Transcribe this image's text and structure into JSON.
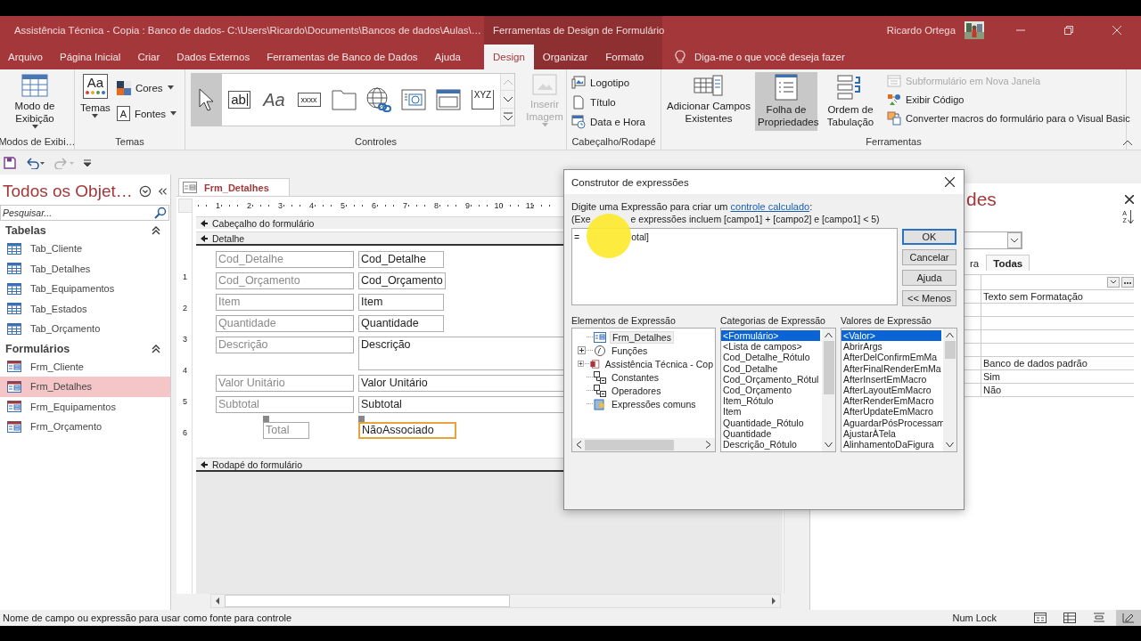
{
  "window": {
    "title": "Assistência Técnica - Copia : Banco de dados- C:\\Users\\Ricardo\\Documents\\Bancos de dados\\Aulas\\…",
    "context_title": "Ferramentas de Design de Formulário",
    "user": "Ricardo Ortega"
  },
  "menu_tabs": [
    {
      "label": "Arquivo",
      "selected": false,
      "context": false
    },
    {
      "label": "Página Inicial",
      "selected": false,
      "context": false
    },
    {
      "label": "Criar",
      "selected": false,
      "context": false
    },
    {
      "label": "Dados Externos",
      "selected": false,
      "context": false
    },
    {
      "label": "Ferramentas de Banco de Dados",
      "selected": false,
      "context": false
    },
    {
      "label": "Ajuda",
      "selected": false,
      "context": false
    },
    {
      "label": "Design",
      "selected": true,
      "context": true
    },
    {
      "label": "Organizar",
      "selected": false,
      "context": true
    },
    {
      "label": "Formato",
      "selected": false,
      "context": true
    }
  ],
  "tell_me": "Diga-me o que você deseja fazer",
  "ribbon": {
    "groups": [
      {
        "kind": "views",
        "label": "Modos de Exibi…",
        "button": "Modo de Exibição"
      },
      {
        "kind": "themes",
        "label": "Temas",
        "big": "Temas",
        "icon_text": "Aa",
        "colors": "Cores",
        "fonts": "Fontes",
        "fonts_icon_text": "A"
      },
      {
        "kind": "controls",
        "label": "Controles",
        "tools": [
          {
            "kind": "pointer",
            "selected": true
          },
          {
            "kind": "textbox",
            "text": "ab",
            "selected": false
          },
          {
            "kind": "label",
            "text": "Aa",
            "selected": false
          },
          {
            "kind": "button",
            "text": "xxxx",
            "selected": false
          },
          {
            "kind": "tab",
            "selected": false
          },
          {
            "kind": "hyperlink",
            "selected": false
          },
          {
            "kind": "webbrowser",
            "selected": false
          },
          {
            "kind": "navigation",
            "selected": false
          },
          {
            "kind": "optiongroup",
            "text": "XYZ",
            "selected": false
          }
        ],
        "insert_image": {
          "label": "Inserir Imagem",
          "disabled": true
        }
      },
      {
        "kind": "header_footer",
        "label": "Cabeçalho/Rodapé",
        "items": [
          {
            "kind": "logo",
            "label": "Logotipo"
          },
          {
            "kind": "title",
            "label": "Título"
          },
          {
            "kind": "datetime",
            "label": "Data e Hora"
          }
        ]
      },
      {
        "kind": "tools",
        "label": "Ferramentas",
        "big": [
          {
            "kind": "fields",
            "label": "Adicionar Campos Existentes",
            "selected": false
          },
          {
            "kind": "properties",
            "label": "Folha de Propriedades",
            "selected": true
          },
          {
            "kind": "taborder",
            "label": "Ordem de Tabulação",
            "selected": false
          }
        ],
        "small": [
          {
            "kind": "subform",
            "label": "Subformulário em Nova Janela",
            "disabled": true
          },
          {
            "kind": "code",
            "label": "Exibir Código",
            "disabled": false
          },
          {
            "kind": "convert",
            "label": "Converter macros do formulário para o Visual Basic",
            "disabled": false
          }
        ]
      }
    ]
  },
  "nav": {
    "title": "Todos os Objet…",
    "search_placeholder": "Pesquisar...",
    "groups": [
      {
        "label": "Tabelas",
        "kind": "table",
        "expanded": true,
        "items": [
          {
            "label": "Tab_Cliente",
            "selected": false
          },
          {
            "label": "Tab_Detalhes",
            "selected": false
          },
          {
            "label": "Tab_Equipamentos",
            "selected": false
          },
          {
            "label": "Tab_Estados",
            "selected": false
          },
          {
            "label": "Tab_Orçamento",
            "selected": false
          }
        ]
      },
      {
        "label": "Formulários",
        "kind": "form",
        "expanded": true,
        "items": [
          {
            "label": "Frm_Cliente",
            "selected": false
          },
          {
            "label": "Frm_Detalhes",
            "selected": true
          },
          {
            "label": "Frm_Equipamentos",
            "selected": false
          },
          {
            "label": "Frm_Orçamento",
            "selected": false
          }
        ]
      }
    ]
  },
  "document": {
    "tab": "Frm_Detalhes",
    "ruler": [
      "1",
      "2",
      "3",
      "4",
      "5",
      "6",
      "7",
      "8",
      "9",
      "10",
      "11"
    ],
    "vruler": [
      "1",
      "2",
      "3",
      "4",
      "5",
      "6"
    ],
    "header": "Cabeçalho do formulário",
    "detail": "Detalhe",
    "footer": "Rodapé do formulário",
    "controls": [
      {
        "label": "Cod_Detalhe",
        "field": "Cod_Detalhe",
        "kind": "short",
        "selected": false
      },
      {
        "label": "Cod_Orçamento",
        "field": "Cod_Orçamento",
        "kind": "short",
        "selected": false
      },
      {
        "label": "Item",
        "field": "Item",
        "kind": "short",
        "selected": false
      },
      {
        "label": "Quantidade",
        "field": "Quantidade",
        "kind": "short",
        "selected": false
      },
      {
        "label": "Descrição",
        "field": "Descrição",
        "kind": "memo",
        "selected": false
      },
      {
        "label": "Valor Unitário",
        "field": "Valor Unitário",
        "kind": "wide",
        "selected": false
      },
      {
        "label": "Subtotal",
        "field": "Subtotal",
        "kind": "wide",
        "selected": false
      },
      {
        "label": "Total",
        "field": "NãoAssociado",
        "kind": "unbound",
        "selected": true
      }
    ]
  },
  "property_sheet": {
    "title": "des",
    "sort_letters": [
      "A",
      "Z"
    ],
    "tabs": [
      {
        "label": "ra",
        "selected": false
      },
      {
        "label": "Todas",
        "selected": true
      }
    ],
    "rows": [
      {
        "builder": true
      },
      {
        "value": "Texto sem Formatação"
      },
      {},
      {},
      {},
      {},
      {
        "value": "Banco de dados padrão"
      },
      {
        "value": "Sim"
      },
      {
        "value": "Não"
      }
    ]
  },
  "dialog": {
    "title": "Construtor de expressões",
    "prompt": "Digite uma Expressão para criar um",
    "link": "controle calculado",
    "prompt_end": ":",
    "hint_parts": [
      "(Exe",
      "e expressões incluem [campo1] + [campo2] e [campo1] < 5)"
    ],
    "expression_parts": [
      "=",
      "otal]"
    ],
    "buttons": [
      {
        "label": "OK",
        "default": true
      },
      {
        "label": "Cancelar",
        "default": false
      },
      {
        "label": "Ajuda",
        "default": false
      },
      {
        "label": "<< Menos",
        "default": false
      }
    ],
    "elements": {
      "heading": "Elementos de Expressão",
      "items": [
        {
          "label": "Frm_Detalhes",
          "kind": "form",
          "expandable": false,
          "selected": true
        },
        {
          "label": "Funções",
          "kind": "functions",
          "expandable": true,
          "selected": false
        },
        {
          "label": "Assistência Técnica - Cop",
          "kind": "database",
          "expandable": true,
          "selected": false
        },
        {
          "label": "Constantes",
          "kind": "constants",
          "expandable": false,
          "selected": false
        },
        {
          "label": "Operadores",
          "kind": "constants",
          "expandable": false,
          "selected": false
        },
        {
          "label": "Expressões comuns",
          "kind": "common",
          "expandable": false,
          "selected": false
        }
      ]
    },
    "categories": {
      "heading": "Categorias de Expressão",
      "items": [
        {
          "label": "<Formulário>",
          "selected": true
        },
        {
          "label": "<Lista de campos>",
          "selected": false
        },
        {
          "label": "Cod_Detalhe_Rótulo",
          "selected": false
        },
        {
          "label": "Cod_Detalhe",
          "selected": false
        },
        {
          "label": "Cod_Orçamento_Rótul",
          "selected": false
        },
        {
          "label": "Cod_Orçamento",
          "selected": false
        },
        {
          "label": "Item_Rótulo",
          "selected": false
        },
        {
          "label": "Item",
          "selected": false
        },
        {
          "label": "Quantidade_Rótulo",
          "selected": false
        },
        {
          "label": "Quantidade",
          "selected": false
        },
        {
          "label": "Descrição_Rótulo",
          "selected": false
        }
      ]
    },
    "values": {
      "heading": "Valores de Expressão",
      "items": [
        {
          "label": "<Valor>",
          "selected": true
        },
        {
          "label": "AbrirArgs",
          "selected": false
        },
        {
          "label": "AfterDelConfirmEmMa",
          "selected": false
        },
        {
          "label": "AfterFinalRenderEmMa",
          "selected": false
        },
        {
          "label": "AfterInsertEmMacro",
          "selected": false
        },
        {
          "label": "AfterLayoutEmMacro",
          "selected": false
        },
        {
          "label": "AfterRenderEmMacro",
          "selected": false
        },
        {
          "label": "AfterUpdateEmMacro",
          "selected": false
        },
        {
          "label": "AguardarPósProcessam",
          "selected": false
        },
        {
          "label": "AjustarÀTela",
          "selected": false
        },
        {
          "label": "AlinhamentoDaFigura",
          "selected": false
        }
      ]
    }
  },
  "status": {
    "text": "Nome de campo ou expressão para usar como fonte para controle",
    "num_lock": "Num Lock",
    "views": [
      {
        "kind": "form",
        "selected": false
      },
      {
        "kind": "datasheet",
        "selected": false
      },
      {
        "kind": "layout",
        "selected": false
      },
      {
        "kind": "design",
        "selected": true
      }
    ]
  }
}
